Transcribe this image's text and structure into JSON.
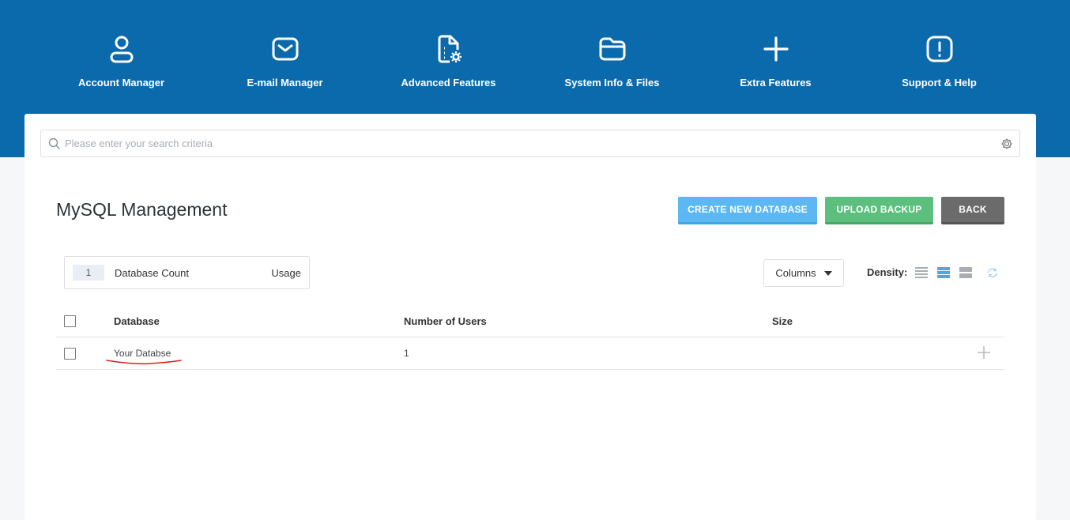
{
  "nav": {
    "items": [
      {
        "label": "Account Manager",
        "icon": "user-icon"
      },
      {
        "label": "E-mail Manager",
        "icon": "mail-icon"
      },
      {
        "label": "Advanced Features",
        "icon": "file-gear-icon"
      },
      {
        "label": "System Info & Files",
        "icon": "folder-icon"
      },
      {
        "label": "Extra Features",
        "icon": "plus-icon"
      },
      {
        "label": "Support & Help",
        "icon": "alert-icon"
      }
    ]
  },
  "search": {
    "placeholder": "Please enter your search criteria",
    "value": ""
  },
  "page": {
    "title": "MySQL Management"
  },
  "actions": {
    "create_label": "CREATE NEW DATABASE",
    "upload_label": "UPLOAD BACKUP",
    "back_label": "BACK"
  },
  "stats": {
    "count": "1",
    "label": "Database Count",
    "usage_label": "Usage"
  },
  "toolbar": {
    "columns_label": "Columns",
    "density_label": "Density:",
    "density_selected": "medium"
  },
  "table": {
    "headers": [
      "Database",
      "Number of Users",
      "Size"
    ],
    "rows": [
      {
        "database": "Your Databse",
        "users": "1",
        "size": ""
      }
    ]
  },
  "colors": {
    "header_bg": "#0b6aab",
    "create_btn": "#5bb8f3",
    "upload_btn": "#5dbf7d",
    "back_btn": "#6b6b6b",
    "annotation": "#e0201c"
  }
}
